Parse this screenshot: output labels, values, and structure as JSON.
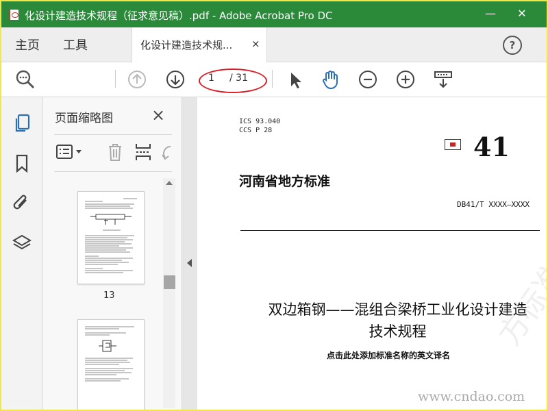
{
  "window": {
    "title": "化设计建造技术规程（征求意见稿）.pdf - Adobe Acrobat Pro DC"
  },
  "menu": {
    "home": "主页",
    "tools": "工具",
    "tab_label": "化设计建造技术规...",
    "tab_close": "×"
  },
  "toolbar": {
    "current_page": "1",
    "total_pages": "/ 31"
  },
  "panel": {
    "title": "页面缩略图",
    "close": "×",
    "thumbnail_page": "13"
  },
  "document": {
    "ics": "ICS  93.040",
    "ccs": "CCS  P 28",
    "std_number": "41",
    "issuer": "河南省地方标准",
    "code": "DB41/T XXXX—XXXX",
    "title_line1": "双边箱钢——混组合梁桥工业化设计建造",
    "title_line2": "技术规程",
    "subtitle": "点击此处添加标准名称的英文译名",
    "watermark": "方标准共服务平台"
  },
  "site": {
    "url": "www.cndao.com"
  },
  "colors": {
    "titlebar": "#2a8a3a",
    "accent_blue": "#2c6fb4",
    "highlight_circle": "#d91f26"
  }
}
